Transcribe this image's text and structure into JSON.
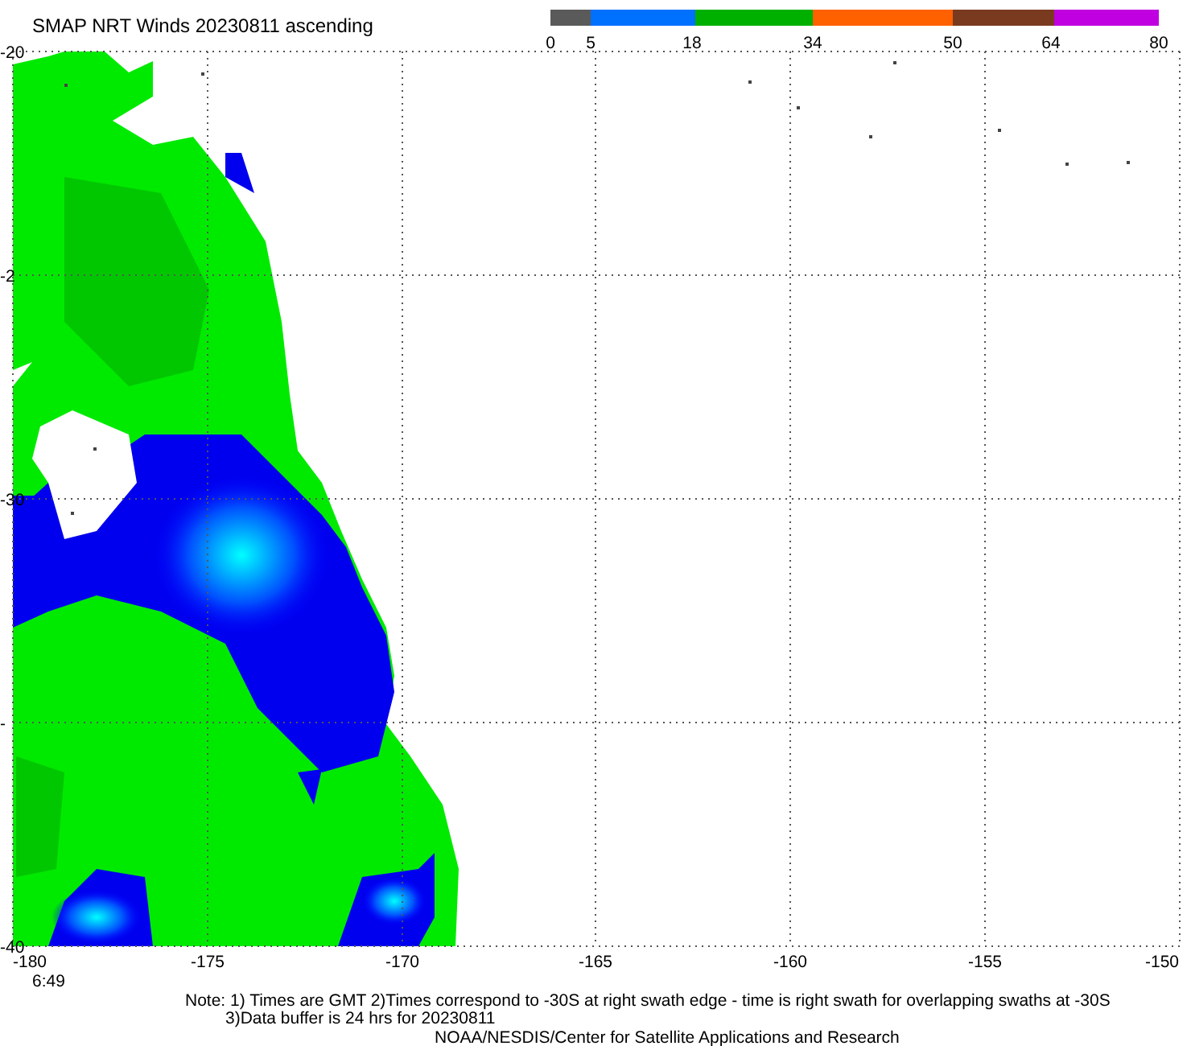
{
  "title": "SMAP NRT Winds 20230811 ascending",
  "colorbar": {
    "segments": [
      {
        "color": "#5a5a5a"
      },
      {
        "color": "#0070ff"
      },
      {
        "color": "#00b000"
      },
      {
        "color": "#ff6000"
      },
      {
        "color": "#7a3a20"
      },
      {
        "color": "#c000e0"
      }
    ],
    "labels": [
      "0",
      "5",
      "18",
      "34",
      "50",
      "64",
      "80"
    ]
  },
  "map": {
    "y_labels": [
      "-20",
      "-2",
      "-30",
      "-",
      "-40"
    ],
    "x_labels": [
      "-180",
      "-175",
      "-170",
      "-165",
      "-160",
      "-155",
      "-150"
    ],
    "time": "6:49"
  },
  "notes": [
    "Note: 1) Times are GMT 2)Times correspond to -30S at right swath edge - time is right swath for overlapping swaths at -30S",
    "3)Data buffer is 24 hrs for 20230811",
    "NOAA/NESDIS/Center for Satellite Applications and Research"
  ]
}
